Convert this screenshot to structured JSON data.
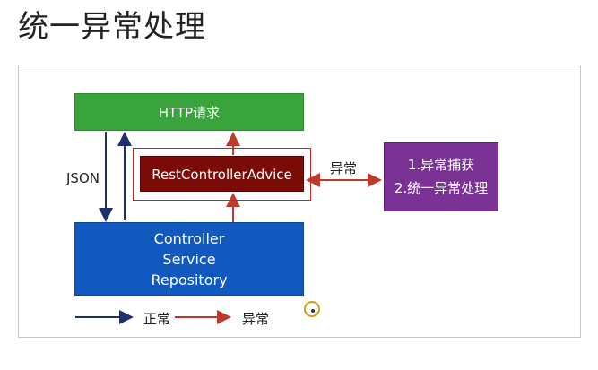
{
  "title": "统一异常处理",
  "boxes": {
    "http": "HTTP请求",
    "advice": "RestControllerAdvice",
    "controller": [
      "Controller",
      "Service",
      "Repository"
    ],
    "handler": [
      "1.异常捕获",
      "2.统一异常处理"
    ]
  },
  "labels": {
    "json": "JSON",
    "exception": "异常"
  },
  "legend": {
    "normal": "正常",
    "exception": "异常"
  },
  "colors": {
    "normal_arrow": "#1f2f6b",
    "exception_arrow": "#c0392b",
    "http_box": "#3aa43c",
    "advice_box": "#7b0b07",
    "controller_box": "#1259bf",
    "handler_box": "#7b3295"
  }
}
